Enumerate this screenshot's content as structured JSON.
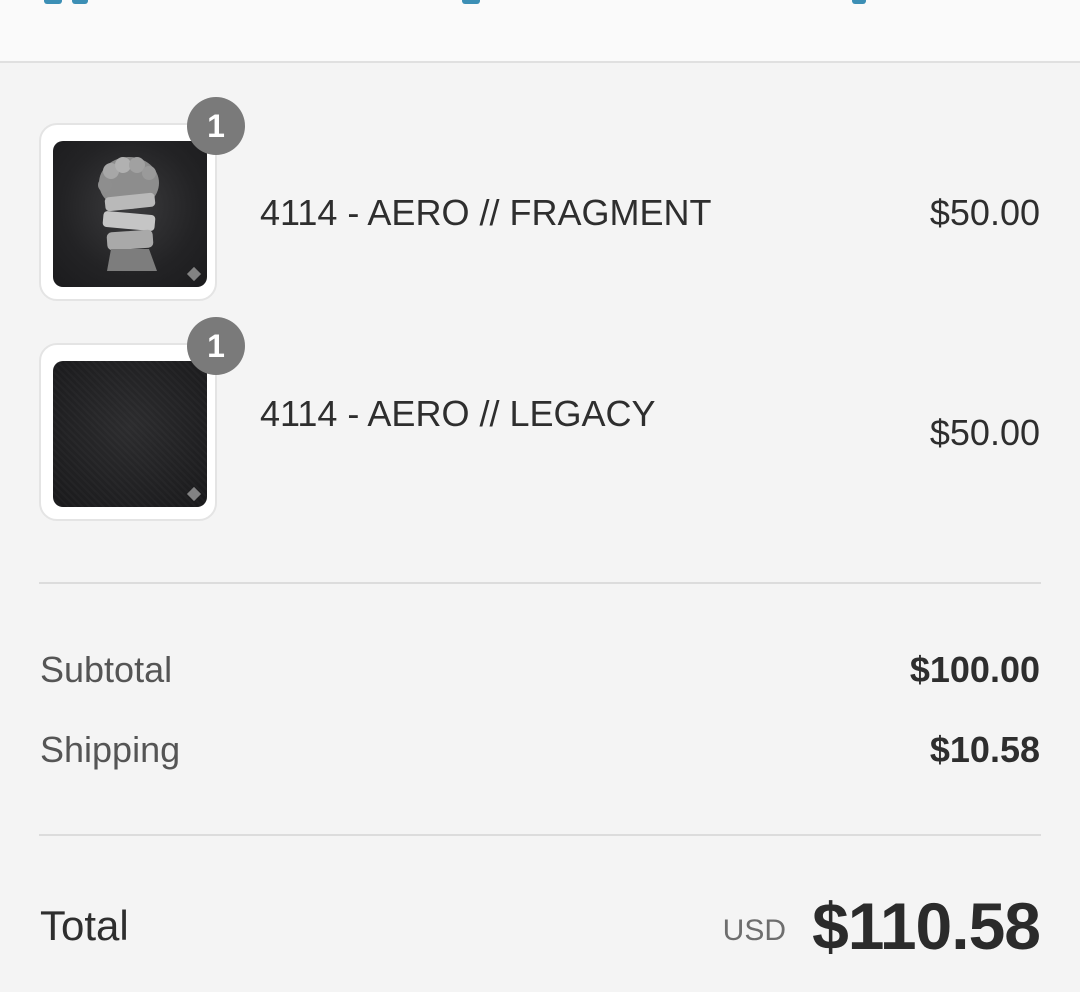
{
  "line_items": [
    {
      "quantity": "1",
      "name": "4114 - AERO // FRAGMENT",
      "price": "$50.00",
      "image_icon": "bust-sculpture-mousepad-icon"
    },
    {
      "quantity": "1",
      "name": "4114 - AERO // LEGACY",
      "price": "$50.00",
      "image_icon": "plain-dark-mousepad-icon"
    }
  ],
  "summary": {
    "subtotal_label": "Subtotal",
    "subtotal_value": "$100.00",
    "shipping_label": "Shipping",
    "shipping_value": "$10.58"
  },
  "total": {
    "label": "Total",
    "currency": "USD",
    "value": "$110.58"
  },
  "colors": {
    "background": "#f4f4f4",
    "badge": "#7a7a7a",
    "accent_link": "#3c8fb5"
  }
}
